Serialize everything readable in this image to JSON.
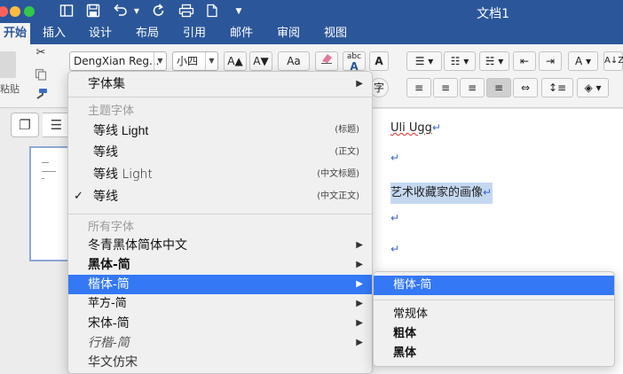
{
  "window": {
    "title": "文档1"
  },
  "quick_access": {
    "icons": [
      "sidebar-icon",
      "save-icon",
      "undo-icon",
      "redo-icon",
      "print-icon",
      "new-doc-icon",
      "customize-icon"
    ]
  },
  "tabs": [
    {
      "label": "开始",
      "active": true
    },
    {
      "label": "插入"
    },
    {
      "label": "设计"
    },
    {
      "label": "布局"
    },
    {
      "label": "引用"
    },
    {
      "label": "邮件"
    },
    {
      "label": "审阅"
    },
    {
      "label": "视图"
    }
  ],
  "ribbon": {
    "paste_label": "粘贴",
    "font_name": "DengXian Reg...",
    "font_size": "小四",
    "grow_font_label": "A▲",
    "shrink_font_label": "A▼",
    "change_case_label": "Aa",
    "abc_label": "abc",
    "border_char_label": "A",
    "enclose_char_label": "字",
    "sort_label": "A↓Z"
  },
  "document": {
    "lines": [
      "Uli Ugg",
      "",
      "艺术收藏家的画像",
      "",
      ""
    ],
    "para_mark": "↵"
  },
  "font_menu": {
    "items": [
      {
        "label": "字体集",
        "type": "submenu"
      },
      {
        "label": "主题字体",
        "type": "header"
      },
      {
        "label": "等线 Light",
        "tag": "(标题)"
      },
      {
        "label": "等线",
        "tag": "(正文)"
      },
      {
        "label": "等线 Light",
        "tag": "(中文标题)"
      },
      {
        "label": "等线",
        "tag": "(中文正文)",
        "checked": true
      },
      {
        "label": "所有字体",
        "type": "header"
      },
      {
        "label": "冬青黑体简体中文",
        "type": "submenu"
      },
      {
        "label": "黑体-简",
        "type": "submenu"
      },
      {
        "label": "楷体-简",
        "type": "submenu",
        "highlighted": true
      },
      {
        "label": "苹方-简",
        "type": "submenu"
      },
      {
        "label": "宋体-简",
        "type": "submenu"
      },
      {
        "label": "行楷-简",
        "type": "submenu"
      },
      {
        "label": "华文仿宋"
      }
    ],
    "check_mark": "✓",
    "arrow": "▶"
  },
  "submenu": {
    "items": [
      {
        "label": "楷体-简",
        "highlighted": true
      },
      {
        "label": "常规体"
      },
      {
        "label": "粗体"
      },
      {
        "label": "黑体"
      }
    ]
  },
  "colors": {
    "titlebar": "#2b579a",
    "highlight": "#3478f6",
    "selection": "#c5d8f2"
  }
}
